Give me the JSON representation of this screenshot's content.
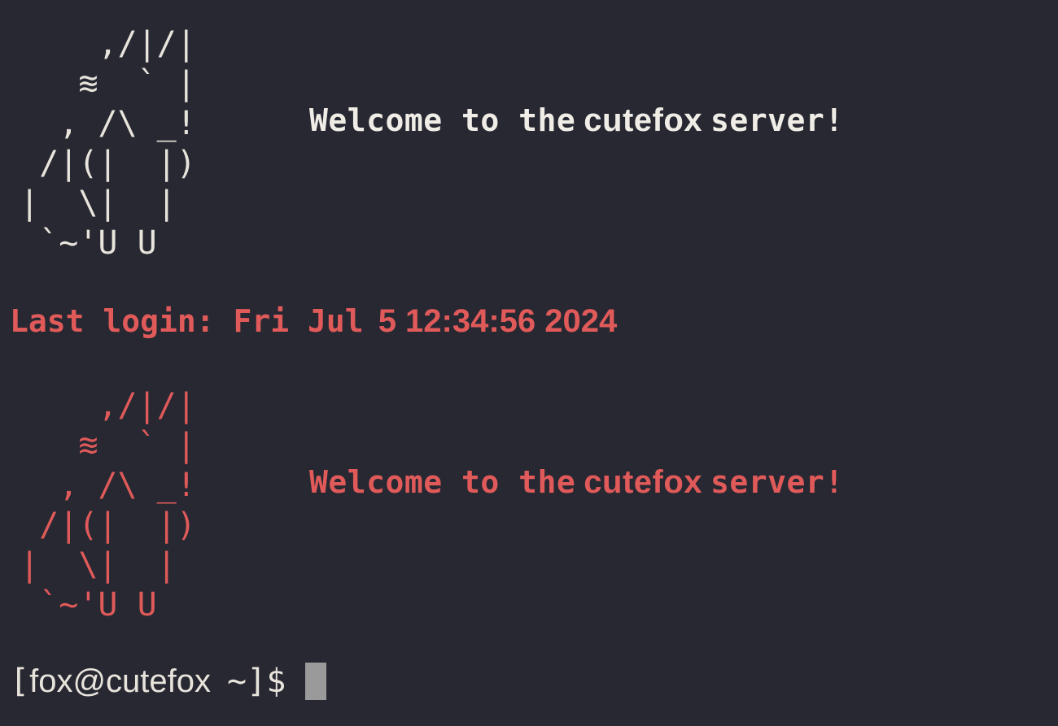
{
  "colors": {
    "background": "#272832",
    "foreground": "#e8e4dc",
    "accent_red": "#e05a5a",
    "cursor": "#9a9a9a"
  },
  "banner_1": {
    "art_lines": [
      "     ,/|/|",
      "    ≋  ` |",
      "   , /\\ _!",
      "  /|(|  |)",
      " |  \\|  |",
      "  `~'U U"
    ],
    "welcome_prefix": "Welcome to the",
    "hostname": "cutefox",
    "welcome_suffix": "server!"
  },
  "last_login": {
    "label": "Last login: Fri Jul",
    "datetime": "5 12:34:56 2024"
  },
  "banner_2": {
    "art_lines": [
      "     ,/|/|",
      "    ≋  ` |",
      "   , /\\ _!",
      "  /|(|  |)",
      " |  \\|  |",
      "  `~'U U"
    ],
    "welcome_prefix": "Welcome to the",
    "hostname": "cutefox",
    "welcome_suffix": "server!"
  },
  "prompt": {
    "open": "[",
    "user_host": "fox@cutefox",
    "path": "~]$"
  }
}
